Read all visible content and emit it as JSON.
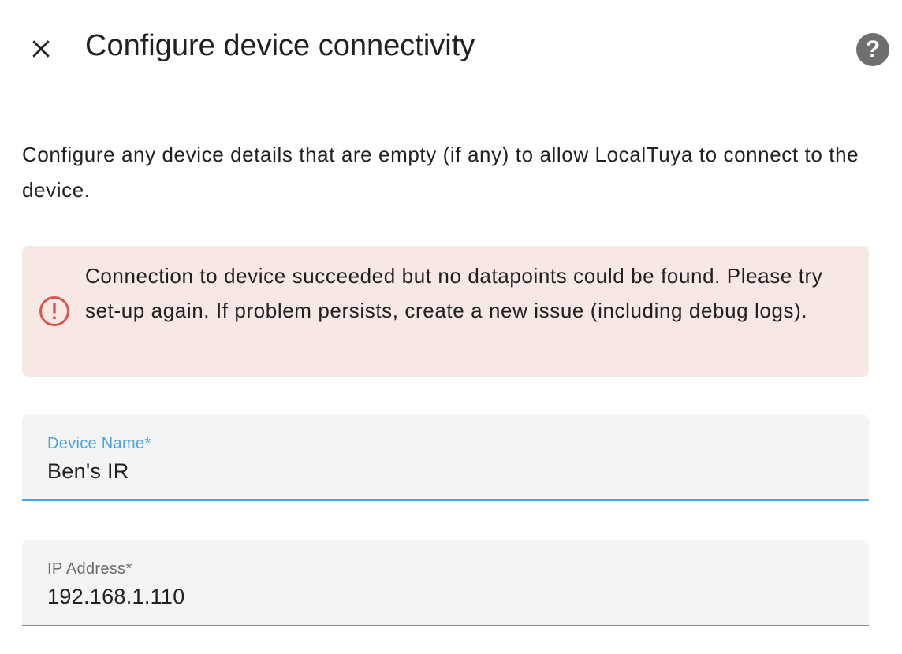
{
  "dialog": {
    "title": "Configure device connectivity",
    "close_icon": "close-icon",
    "help_icon": "help-circle-icon",
    "description": "Configure any device details that are empty (if any) to allow LocalTuya to connect to the device."
  },
  "alert": {
    "icon": "alert-circle-icon",
    "message": "Connection to device succeeded but no datapoints could be found. Please try set-up again. If problem persists, create a new issue (including debug logs).",
    "background_color": "#f7e7e5",
    "icon_color": "#d9534f"
  },
  "fields": {
    "device_name": {
      "label": "Device Name*",
      "value": "Ben's IR",
      "state": "focused"
    },
    "ip_address": {
      "label": "IP Address*",
      "value": "192.168.1.110",
      "state": "unfocused"
    }
  },
  "colors": {
    "accent": "#4aa3e3",
    "text": "#212121",
    "help_icon": "#6f6f6f"
  }
}
